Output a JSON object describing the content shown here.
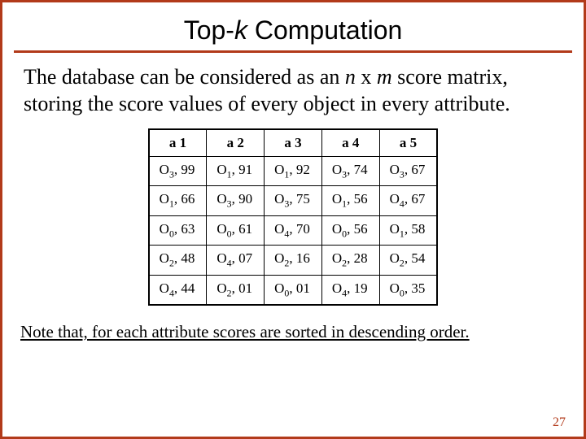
{
  "title": {
    "pre": "Top-",
    "k": "k",
    "post": " Computation"
  },
  "paragraph": {
    "p1": "The database can be considered as an ",
    "n": "n",
    "p2": " x ",
    "m": "m",
    "p3": " score matrix, storing the score values of every object in every attribute."
  },
  "table": {
    "headers": [
      "a 1",
      "a 2",
      "a 3",
      "a 4",
      "a 5"
    ],
    "rows": [
      [
        {
          "o": "3",
          "v": "99"
        },
        {
          "o": "1",
          "v": "91"
        },
        {
          "o": "1",
          "v": "92"
        },
        {
          "o": "3",
          "v": "74"
        },
        {
          "o": "3",
          "v": "67"
        }
      ],
      [
        {
          "o": "1",
          "v": "66"
        },
        {
          "o": "3",
          "v": "90"
        },
        {
          "o": "3",
          "v": "75"
        },
        {
          "o": "1",
          "v": "56"
        },
        {
          "o": "4",
          "v": "67"
        }
      ],
      [
        {
          "o": "0",
          "v": "63"
        },
        {
          "o": "0",
          "v": "61"
        },
        {
          "o": "4",
          "v": "70"
        },
        {
          "o": "0",
          "v": "56"
        },
        {
          "o": "1",
          "v": "58"
        }
      ],
      [
        {
          "o": "2",
          "v": "48"
        },
        {
          "o": "4",
          "v": "07"
        },
        {
          "o": "2",
          "v": "16"
        },
        {
          "o": "2",
          "v": "28"
        },
        {
          "o": "2",
          "v": "54"
        }
      ],
      [
        {
          "o": "4",
          "v": "44"
        },
        {
          "o": "2",
          "v": "01"
        },
        {
          "o": "0",
          "v": "01"
        },
        {
          "o": "4",
          "v": "19"
        },
        {
          "o": "0",
          "v": "35"
        }
      ]
    ]
  },
  "note": "Note that, for each attribute scores are sorted in descending order.",
  "page": "27"
}
